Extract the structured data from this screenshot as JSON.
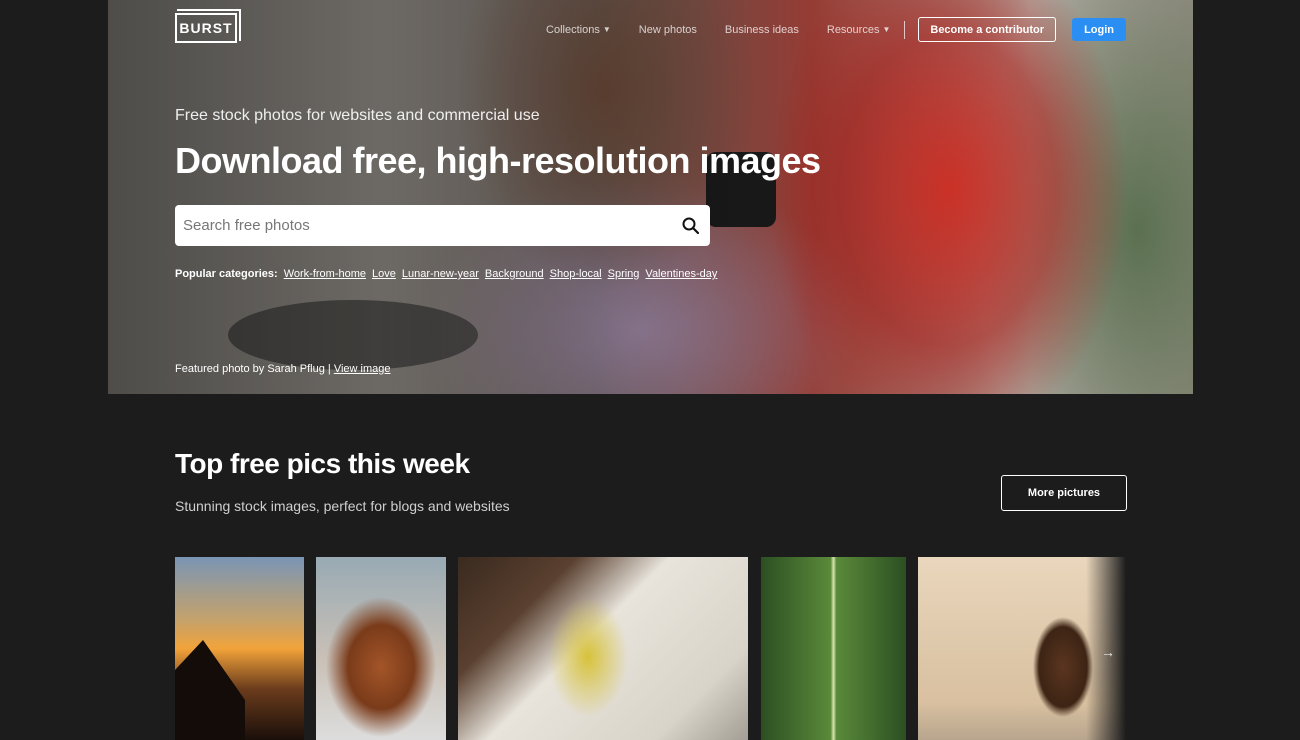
{
  "brand": {
    "logo_text": "BURST"
  },
  "nav": {
    "items": [
      {
        "label": "Collections",
        "has_caret": true
      },
      {
        "label": "New photos",
        "has_caret": false
      },
      {
        "label": "Business ideas",
        "has_caret": false
      },
      {
        "label": "Resources",
        "has_caret": true
      }
    ],
    "contributor_label": "Become a contributor",
    "login_label": "Login",
    "login_color": "#2b8ef2"
  },
  "hero": {
    "tagline": "Free stock photos for websites and commercial use",
    "headline": "Download free, high-resolution images",
    "search_placeholder": "Search free photos",
    "search_icon": "search-icon",
    "popular_label": "Popular categories:",
    "categories": [
      "Work-from-home",
      "Love",
      "Lunar-new-year",
      "Background",
      "Shop-local",
      "Spring",
      "Valentines-day"
    ],
    "featured_text": "Featured photo by Sarah Pflug |",
    "featured_link": "View image"
  },
  "top_pics": {
    "title": "Top free pics this week",
    "subtitle": "Stunning stock images, perfect for blogs and websites",
    "more_label": "More pictures",
    "next_icon": "arrow-right-icon",
    "next_glyph": "→"
  }
}
